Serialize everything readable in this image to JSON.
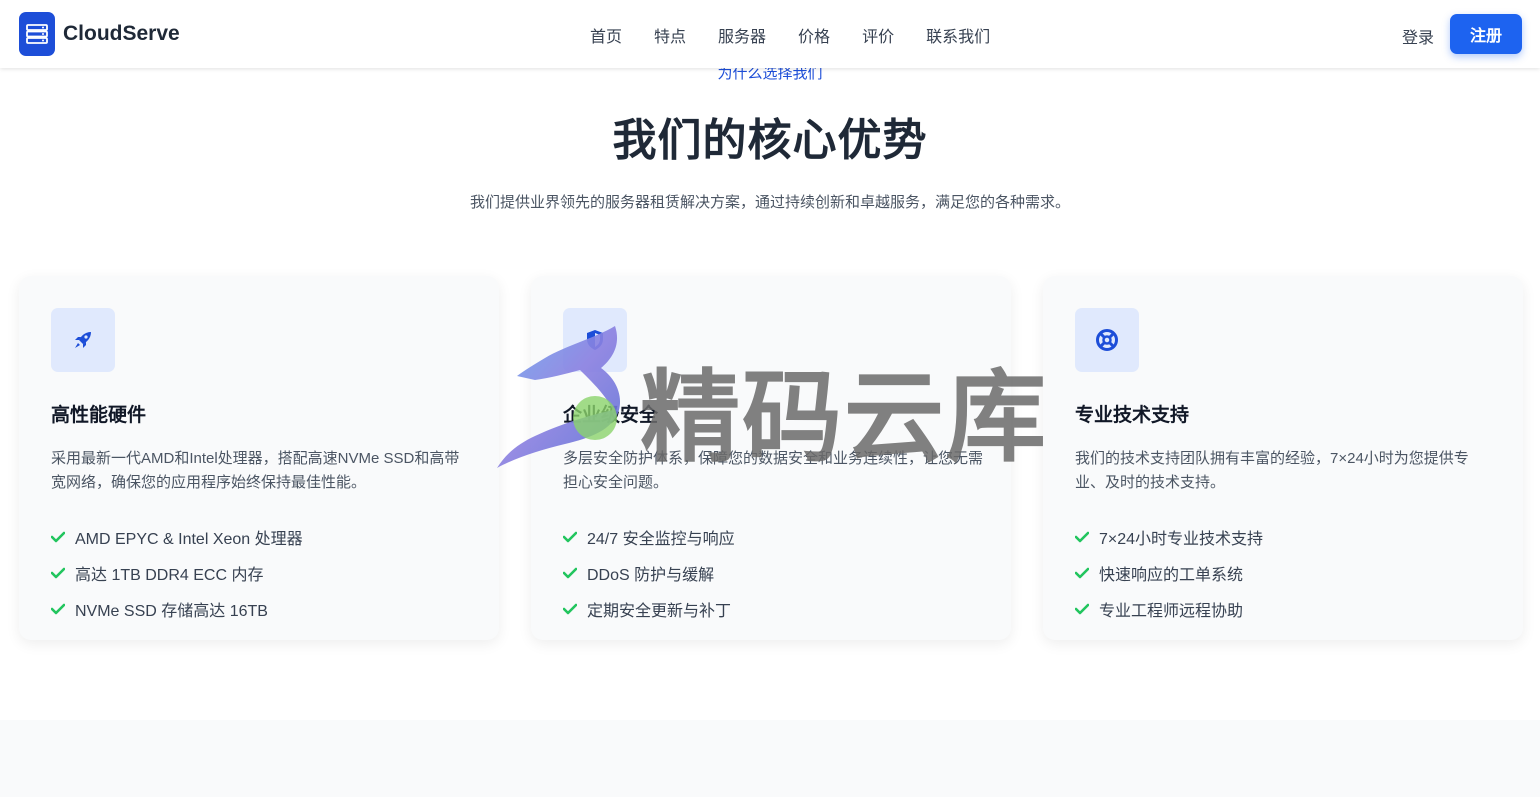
{
  "brand": {
    "name": "CloudServe",
    "accent": "#1d4ed8"
  },
  "nav": {
    "items": [
      "首页",
      "特点",
      "服务器",
      "价格",
      "评价",
      "联系我们"
    ]
  },
  "auth": {
    "login": "登录",
    "register": "注册"
  },
  "section": {
    "eyebrow": "为什么选择我们",
    "title": "我们的核心优势",
    "subtitle": "我们提供业界领先的服务器租赁解决方案，通过持续创新和卓越服务，满足您的各种需求。"
  },
  "cards": [
    {
      "icon": "rocket-icon",
      "title": "高性能硬件",
      "desc": "采用最新一代AMD和Intel处理器，搭配高速NVMe SSD和高带宽网络，确保您的应用程序始终保持最佳性能。",
      "features": [
        "AMD EPYC & Intel Xeon 处理器",
        "高达 1TB DDR4 ECC 内存",
        "NVMe SSD 存储高达 16TB"
      ]
    },
    {
      "icon": "shield-icon",
      "title": "企业级安全",
      "desc": "多层安全防护体系，保障您的数据安全和业务连续性，让您无需担心安全问题。",
      "features": [
        "24/7 安全监控与响应",
        "DDoS 防护与缓解",
        "定期安全更新与补丁"
      ]
    },
    {
      "icon": "lifebuoy-icon",
      "title": "专业技术支持",
      "desc": "我们的技术支持团队拥有丰富的经验，7×24小时为您提供专业、及时的技术支持。",
      "features": [
        "7×24小时专业技术支持",
        "快速响应的工单系统",
        "专业工程师远程协助"
      ]
    }
  ],
  "watermark": {
    "text": "精码云库"
  },
  "colors": {
    "primary": "#1d63f0",
    "check": "#22c55e",
    "card_bg": "#f9fafb",
    "icon_bg": "#e0e9fd"
  }
}
